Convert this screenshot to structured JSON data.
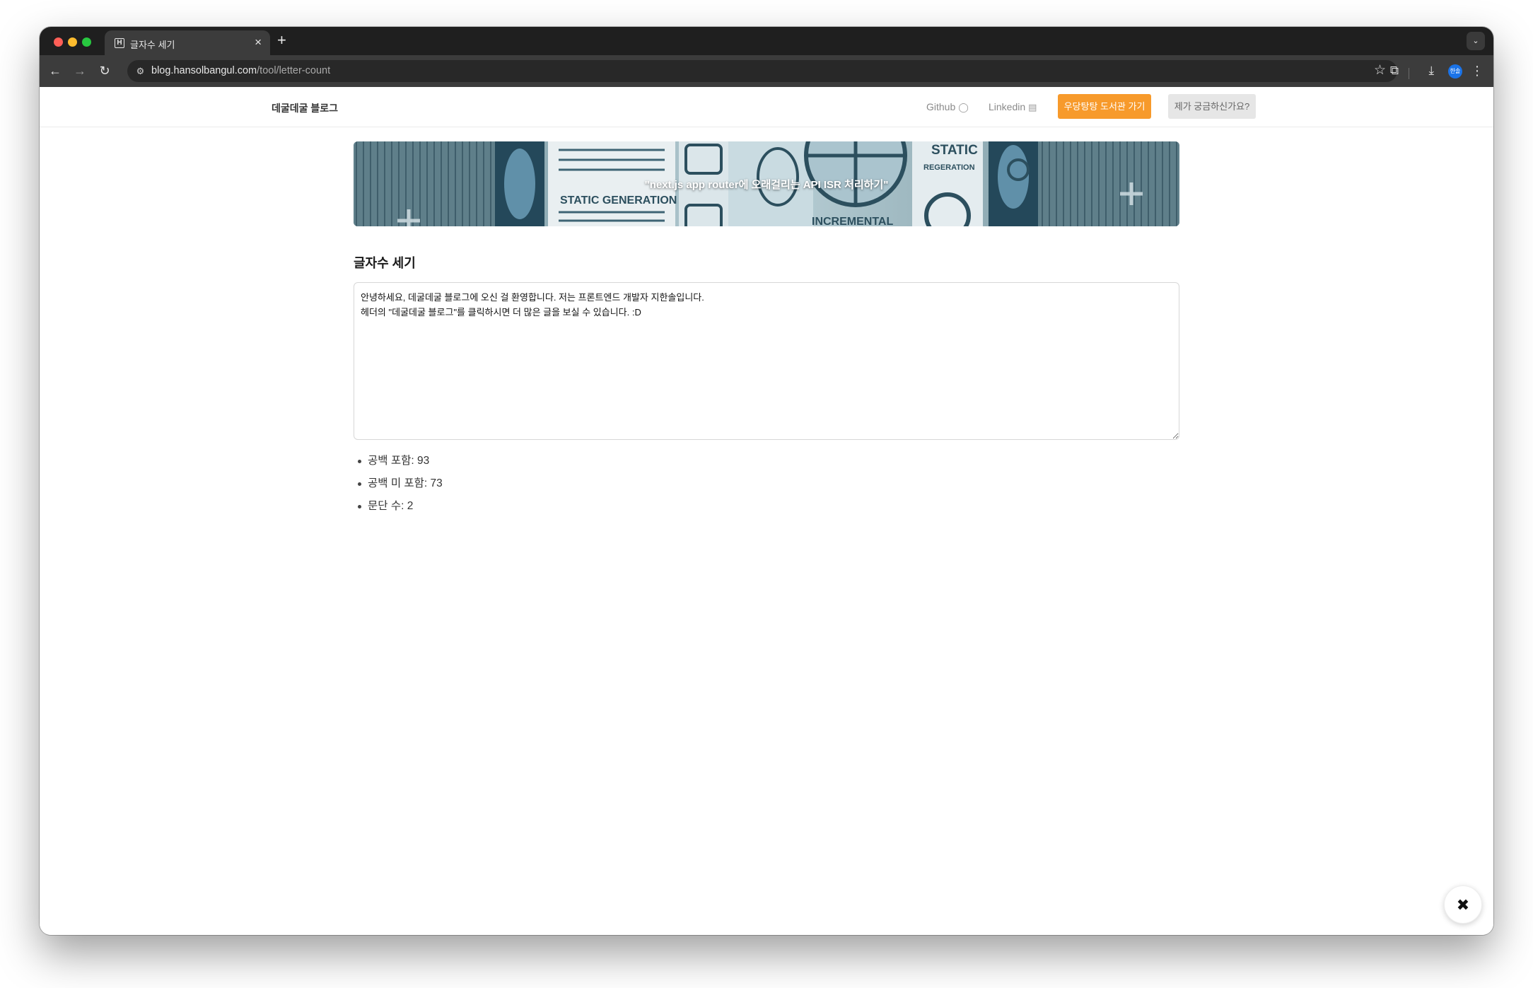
{
  "browser": {
    "tab_title": "글자수 세기",
    "tab_favicon": "H",
    "tab_close": "×",
    "new_tab": "+",
    "url_host": "blog.hansolbangul.com",
    "url_path": "/tool/letter-count",
    "profile_label": "한솔",
    "icons": [
      "back-icon",
      "forward-icon",
      "reload-icon",
      "site-info-icon",
      "bookmark-star-icon",
      "extensions-icon",
      "download-icon",
      "menu-icon",
      "tab-search-icon"
    ]
  },
  "header": {
    "blog_title": "데굴데굴 블로그",
    "github_label": "Github",
    "linkedin_label": "Linkedin",
    "library_button": "우당탕탕 도서관 가기",
    "question_button": "제가 궁금하신가요?"
  },
  "banner": {
    "caption": "\"next.js app router에 오래걸리는 API ISR 처리하기\"",
    "image_text": {
      "static_generation": "STATIC GENERATION",
      "static": "STATIC",
      "regeneration": "REGERATION",
      "incremental": "INCREMENTAL"
    }
  },
  "tool": {
    "title": "글자수 세기",
    "text": "안녕하세요, 데굴데굴 블로그에 오신 걸 환영합니다. 저는 프론트엔드 개발자 지한솔입니다.\n헤더의 \"데굴데굴 블로그\"를 클릭하시면 더 많은 글을 보실 수 있습니다. :D",
    "stats": [
      {
        "label": "공백 포함: 93"
      },
      {
        "label": "공백 미 포함: 73"
      },
      {
        "label": "문단 수: 2"
      }
    ]
  },
  "fab": {
    "icon": "tools-icon",
    "glyph": "✖"
  },
  "colors": {
    "accent_orange": "#f79a2b",
    "secondary_gray": "#e6e6e6",
    "chrome_dark": "#1f1f1f",
    "chrome_toolbar": "#3c3c3c"
  }
}
